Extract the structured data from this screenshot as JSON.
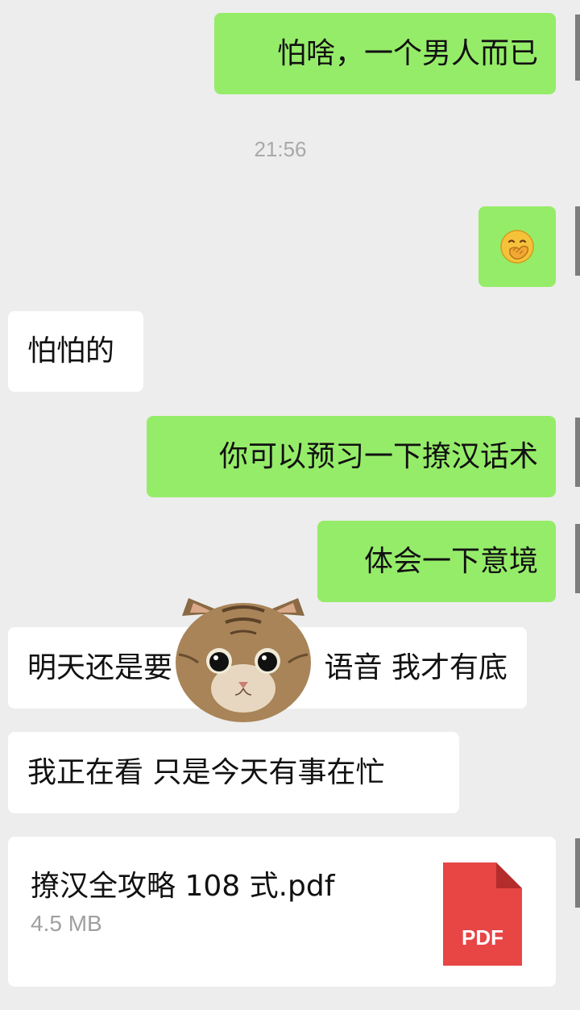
{
  "chat": {
    "messages": [
      {
        "side": "out",
        "text": "怕啥，一个男人而已"
      },
      {
        "side": "out",
        "emoji": "hand-over-mouth-emoji"
      },
      {
        "side": "in",
        "text": "怕怕的"
      },
      {
        "side": "out",
        "text": "你可以预习一下撩汉话术"
      },
      {
        "side": "out",
        "text": "体会一下意境"
      },
      {
        "side": "in",
        "text": "明天还是要",
        "hidden_by_sticker": true
      },
      {
        "side": "in",
        "text_after_sticker": "语音 我才有底"
      },
      {
        "side": "in",
        "text": "我正在看 只是今天有事在忙"
      }
    ],
    "timestamp": "21:56",
    "file": {
      "name": "撩汉全攻略 108 式.pdf",
      "size": "4.5 MB",
      "type_label": "PDF"
    },
    "sticker": "cat-face-sticker"
  },
  "colors": {
    "background": "#ededed",
    "outgoing_bubble": "#95ec69",
    "incoming_bubble": "#ffffff",
    "pdf_red": "#e84545",
    "timestamp_text": "#a9a9a9"
  }
}
